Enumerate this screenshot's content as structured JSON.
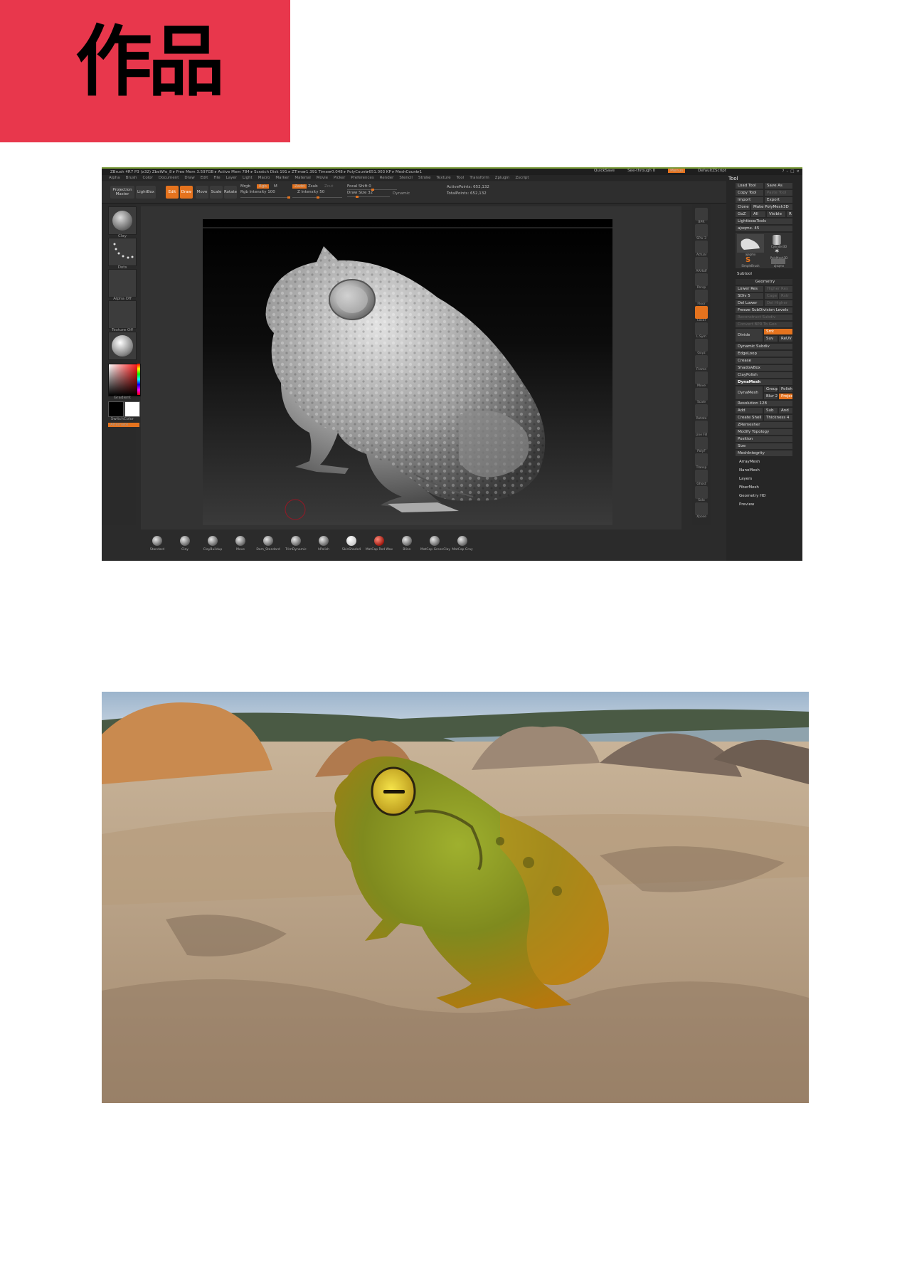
{
  "banner": {
    "title": "作品",
    "color": "#e8374c"
  },
  "zbrush": {
    "titlebar": "ZBrush 4R7 P3 (x32)   ZbeWfo_8   ▸ Free Mem 3.597GB ▸ Active Mem 784 ▸ Scratch Disk 191 ▸ ZTime▸1.391 Timer▸0.048 ▸ PolyCount▸651.003 KP ▸ MeshCount▸1",
    "quicksave": "QuickSave",
    "see_through": "See-through  0",
    "menus_label": "Menus",
    "default_script": "DefaultZScript",
    "menu": [
      "Alpha",
      "Brush",
      "Color",
      "Document",
      "Draw",
      "Edit",
      "File",
      "Layer",
      "Light",
      "Macro",
      "Marker",
      "Material",
      "Movie",
      "Picker",
      "Preferences",
      "Render",
      "Stencil",
      "Stroke",
      "Texture",
      "Tool",
      "Transform",
      "Zplugin",
      "Zscript"
    ],
    "shelf": {
      "projection_master": "Projection Master",
      "lightbox": "LightBox",
      "edit": "Edit",
      "draw": "Draw",
      "move": "Move",
      "scale": "Scale",
      "rotate": "Rotate",
      "mrgb": "Mrgb",
      "rgb": "Rgb",
      "m": "M",
      "zadd": "Zadd",
      "zsub": "Zsub",
      "zcut": "Zcut",
      "rgb_intensity": "Rgb Intensity 100",
      "z_intensity": "Z Intensity 50",
      "focal_shift": "Focal Shift 0",
      "draw_size": "Draw Size 32",
      "dynamic": "Dynamic",
      "active_points": "ActivePoints: 652,132",
      "total_points": "TotalPoints: 652,132"
    },
    "left_captions": [
      "Clay",
      "Dots",
      "Alpha Off",
      "Texture Off",
      "Gradient",
      "SwitchColor",
      "Alternate"
    ],
    "right_tools": [
      "BPR",
      "SPix 3",
      "Actual",
      "AAHalf",
      "Persp",
      "Floor",
      "Local",
      "L.Sym",
      "Gxyz",
      "Frame",
      "Move",
      "Scale",
      "Rotate",
      "Line Fill",
      "PolyF",
      "Transp",
      "Ghost",
      "Solo",
      "Xpose"
    ],
    "tool_panel": {
      "title": "Tool",
      "load_tool": "Load Tool",
      "save_as": "Save As",
      "copy_tool": "Copy Tool",
      "paste_tool": "Paste Tool",
      "import": "Import",
      "export": "Export",
      "clone": "Clone",
      "make_polymesh": "Make PolyMesh3D",
      "goz": "GoZ",
      "all": "All",
      "visible": "Visible",
      "r": "R",
      "lightbox_tools": "Lightbox▸Tools",
      "current_tool": "ajsqmx. 45",
      "thumbs": [
        "ajsqmx",
        "Cylinder3D",
        "PolyMesh3D",
        "SimpleBrush",
        "ajsqmx"
      ],
      "subtool": "Subtool",
      "geometry": "Geometry",
      "lower_res": "Lower Res",
      "higher_res": "Higher Res",
      "sdiv": "SDiv 5",
      "cage": "Cage",
      "rstr": "Rstr",
      "del_lower": "Del Lower",
      "del_higher": "Del Higher",
      "freeze": "Freeze SubDivision Levels",
      "reconstruct": "Reconstruct Subdiv",
      "convert_bpr": "Convert BPR To Geo",
      "divide": "Divide",
      "smt": "Smt",
      "suv": "Suv",
      "reuv": "ReUV",
      "dynamic_subdiv": "Dynamic Subdiv",
      "edgeloop": "EdgeLoop",
      "crease": "Crease",
      "shadowbox": "ShadowBox",
      "claypolish": "ClayPolish",
      "dynamesh_hdr": "DynaMesh",
      "dynamesh": "DynaMesh",
      "groups": "Groups",
      "polish": "Polish",
      "blur": "Blur 2",
      "project": "Project",
      "resolution": "Resolution 128",
      "add": "Add",
      "sub": "Sub",
      "and": "And",
      "create_shell": "Create Shell",
      "thickness": "Thickness 4",
      "zremesher": "ZRemesher",
      "modify_topology": "Modify Topology",
      "position": "Position",
      "size": "Size",
      "meshintegrity": "MeshIntegrity",
      "arraymesh": "ArrayMesh",
      "nanomesh": "NanoMesh",
      "layers": "Layers",
      "fibermesh": "FiberMesh",
      "geometry_hd": "Geometry HD",
      "preview": "Preview"
    },
    "materials": [
      "Standard",
      "Clay",
      "ClayBuildup",
      "Move",
      "Dam_Standard",
      "TrimDynamic",
      "hPolish",
      "SkinShade4",
      "MatCap Red Wax",
      "Blinn",
      "MatCap GreenClay",
      "MatCap Gray"
    ]
  }
}
